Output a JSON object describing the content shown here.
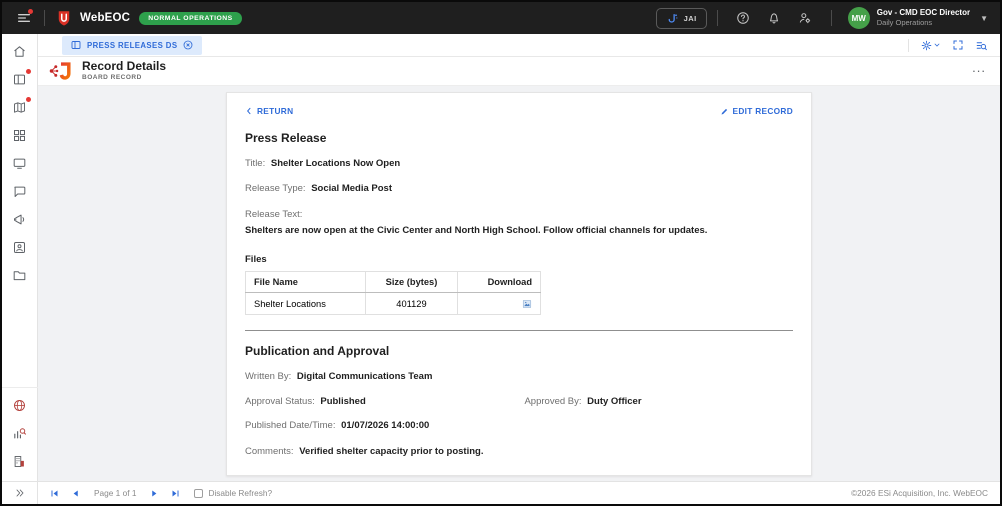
{
  "topbar": {
    "app_name": "WebEOC",
    "status_badge": "NORMAL OPERATIONS",
    "jai_label": "JAI",
    "user_name": "Gov - CMD EOC Director",
    "user_role": "Daily Operations",
    "avatar_initials": "MW"
  },
  "tabbar": {
    "active_tab": "PRESS RELEASES DS"
  },
  "board_header": {
    "title": "Record Details",
    "subtitle": "BOARD RECORD",
    "menu_label": "..."
  },
  "record": {
    "return_label": "RETURN",
    "edit_label": "EDIT RECORD",
    "heading": "Press Release",
    "fields": [
      {
        "label": "Title:",
        "value": "Shelter Locations Now Open"
      },
      {
        "label": "Release Type:",
        "value": "Social Media Post"
      },
      {
        "label": "Release Text:",
        "value": "Shelters are now open at the Civic Center and North High School. Follow official channels for updates."
      }
    ],
    "files": {
      "heading": "Files",
      "columns": [
        "File Name",
        "Size (bytes)",
        "Download"
      ],
      "rows": [
        {
          "name": "Shelter Locations",
          "size": "401129"
        }
      ]
    },
    "publication": {
      "heading": "Publication and Approval",
      "written_by_label": "Written By:",
      "written_by": "Digital Communications Team",
      "approval_status_label": "Approval Status:",
      "approval_status": "Published",
      "approved_by_label": "Approved By:",
      "approved_by": "Duty Officer",
      "published_label": "Published Date/Time:",
      "published": "01/07/2026 14:00:00",
      "comments_label": "Comments:",
      "comments": "Verified shelter capacity prior to posting."
    }
  },
  "footer": {
    "page_text": "Page 1 of 1",
    "disable_refresh_label": "Disable Refresh?",
    "copyright": "©2026 ESi Acquisition, Inc. WebEOC"
  },
  "colors": {
    "accent_blue": "#2f6bd8",
    "badge_green": "#2ea04c",
    "avatar_green": "#45a049",
    "brand_red": "#d93025",
    "topbar_bg": "#1f1f1f",
    "content_bg": "#f1f2f4"
  },
  "icons": {
    "menu-icon": "hamburger lines + red notification dot",
    "webeoc-shield-icon": "red shield logo",
    "jai-icon": "blue J spark glyph",
    "help-icon": "? in circle",
    "bell-icon": "notification bell",
    "user-admin-icon": "person with gear",
    "chevron-down-icon": "▾",
    "board-tab-icon": "split-panel board",
    "close-tab-icon": "x in circle",
    "gear-icon": "settings gear + caret",
    "fullscreen-icon": "corner brackets",
    "list-search-icon": "lines + magnifier",
    "record-details-logo": "red J with network nodes",
    "ellipsis-icon": "...",
    "home-icon": "house",
    "boards-icon": "split panel + red dot",
    "maps-icon": "folded map + red dot",
    "apps-grid-icon": "four squares",
    "displays-icon": "monitor",
    "chat-icon": "speech bubble",
    "megaphone-icon": "megaphone",
    "contacts-icon": "person card",
    "folder-icon": "folder",
    "globe-icon": "globe (red)",
    "analytics-icon": "bar chart with red magnifier",
    "organization-icon": "building with red block",
    "double-chevron-icon": "»",
    "chevron-left-icon": "‹",
    "pencil-icon": "edit pencil",
    "download-file-icon": "small blue image file",
    "pager-first-icon": "|◀",
    "pager-prev-icon": "◀",
    "pager-next-icon": "▶",
    "pager-last-icon": "▶|"
  }
}
